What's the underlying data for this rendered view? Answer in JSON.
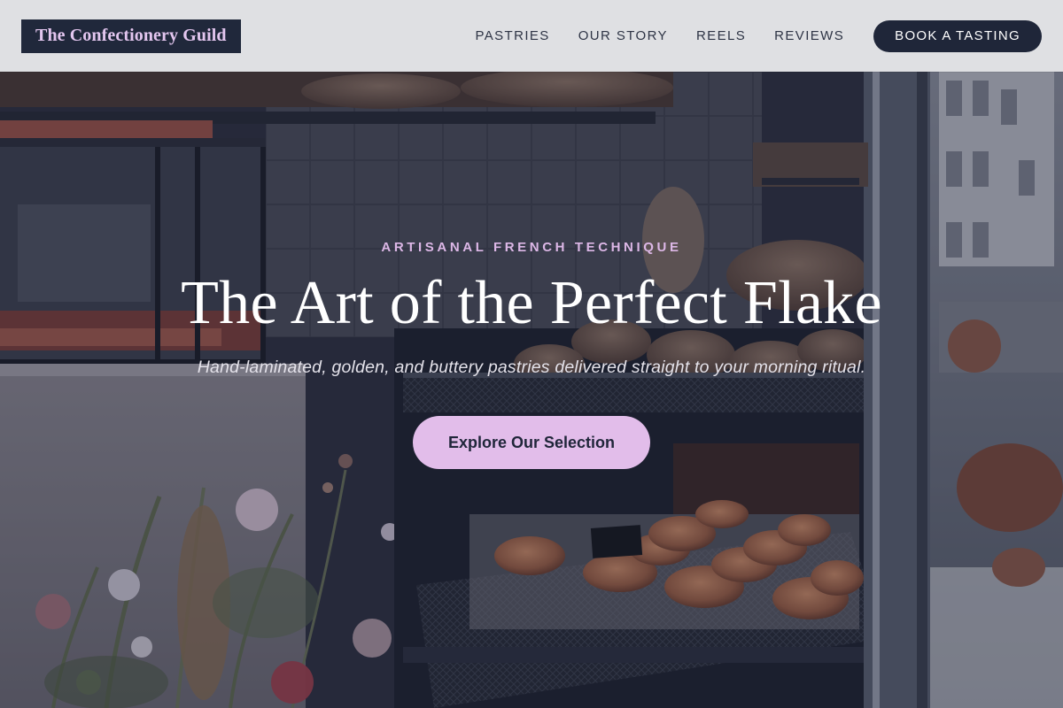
{
  "header": {
    "logo": "The Confectionery Guild",
    "nav": [
      {
        "label": "PASTRIES"
      },
      {
        "label": "OUR STORY"
      },
      {
        "label": "REELS"
      },
      {
        "label": "REVIEWS"
      }
    ],
    "cta_label": "BOOK A TASTING"
  },
  "hero": {
    "eyebrow": "ARTISANAL FRENCH TECHNIQUE",
    "headline": "The Art of the Perfect Flake",
    "subhead": "Hand-laminated, golden, and buttery pastries delivered straight to your morning ritual.",
    "cta_label": "Explore Our Selection",
    "background_icon": "bakery-display-photo"
  },
  "colors": {
    "header_bg": "#dfe0e3",
    "logo_bg": "#20283b",
    "logo_text": "#e3c6ef",
    "accent": "#e2bdea",
    "dark": "#1f2639"
  }
}
